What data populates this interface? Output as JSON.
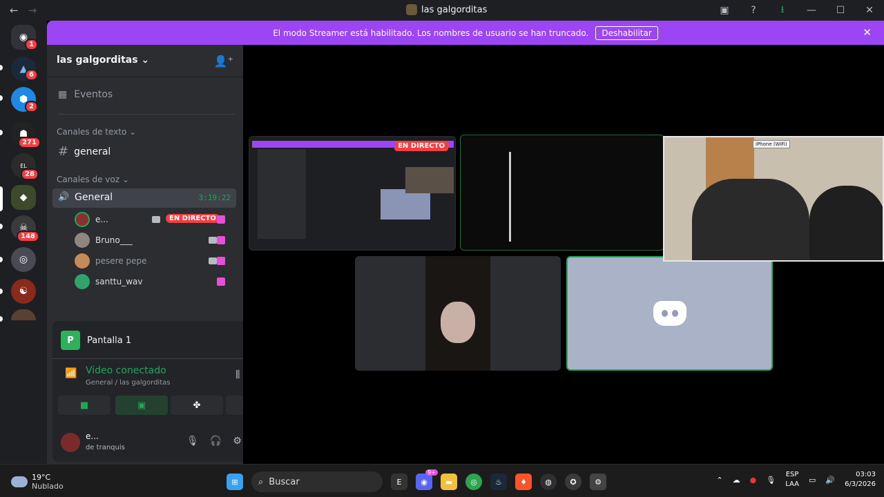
{
  "window": {
    "title": "las galgorditas",
    "back_icon": "arrow-left-icon",
    "forward_icon": "arrow-right-icon"
  },
  "servers": [
    {
      "name": "discord-home",
      "badge": "1"
    },
    {
      "name": "server-2",
      "badge": "6"
    },
    {
      "name": "server-3",
      "badge": "2"
    },
    {
      "name": "server-4",
      "badge": "271"
    },
    {
      "name": "server-5",
      "badge": "28"
    },
    {
      "name": "server-6",
      "badge": ""
    },
    {
      "name": "server-7",
      "badge": "148"
    },
    {
      "name": "server-8",
      "badge": ""
    },
    {
      "name": "server-9",
      "badge": ""
    },
    {
      "name": "server-10",
      "badge": ""
    }
  ],
  "banner": {
    "text": "El modo Streamer está habilitado. Los nombres de usuario se han truncado.",
    "button": "Deshabilitar",
    "close": "✕"
  },
  "sidebar": {
    "guild_name": "las galgorditas ⌄",
    "events_label": "Eventos",
    "text_category": "Canales de texto ⌄",
    "text_channel": "general",
    "voice_category": "Canales de voz ⌄",
    "voice_channel": "General",
    "voice_time": "3:19:22",
    "voice_users": [
      {
        "name": "e...",
        "live": "EN DIRECTO",
        "color": "#8a3030"
      },
      {
        "name": "Bruno___",
        "live": "",
        "color": "#8e8680"
      },
      {
        "name": "pesere pepe",
        "live": "",
        "color": "#c48a5a"
      },
      {
        "name": "santtu_wav",
        "live": "",
        "color": "#2fa36b"
      }
    ]
  },
  "panel": {
    "screen_label": "Pantalla 1",
    "screen_letter": "P",
    "video_status": "Video conectado",
    "video_location": "General / las galgorditas",
    "user_name": "e...",
    "user_status": "de tranquis"
  },
  "stage": {
    "live_badge": "EN DIRECTO",
    "pip_tag": "iPhone (WiFi)"
  },
  "taskbar": {
    "temp": "19°C",
    "condition": "Nublado",
    "search_placeholder": "Buscar",
    "lang_top": "ESP",
    "lang_bottom": "LAA",
    "time": "03:03",
    "date": "6/3/2026",
    "discord_badge": "9+"
  }
}
